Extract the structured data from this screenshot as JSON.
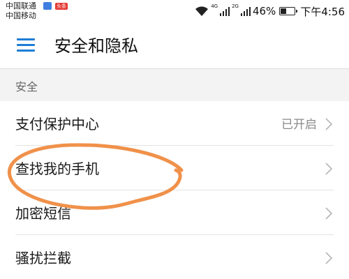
{
  "status_bar": {
    "carrier_1": "中国联通",
    "carrier_2": "中国移动",
    "app_badge": "头条",
    "net_1": "4G",
    "net_2": "2G",
    "battery_text": "46%",
    "battery_level": 0.46,
    "time": "下午4:56"
  },
  "app_bar": {
    "title": "安全和隐私",
    "menu_icon": "hamburger-menu-icon",
    "accent_color": "#1e7ed6"
  },
  "section": {
    "header": "安全",
    "items": [
      {
        "label": "支付保护中心",
        "value": "已开启"
      },
      {
        "label": "查找我的手机",
        "value": ""
      },
      {
        "label": "加密短信",
        "value": ""
      },
      {
        "label": "骚扰拦截",
        "value": ""
      }
    ]
  },
  "annotation": {
    "color": "#f0914a",
    "shape": "hand-drawn-loop"
  }
}
